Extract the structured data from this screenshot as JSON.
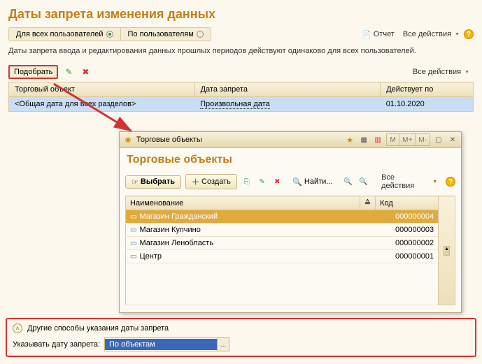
{
  "pageTitle": "Даты запрета изменения данных",
  "tabs": {
    "all": "Для всех пользователей",
    "byUsers": "По пользователям"
  },
  "topActions": {
    "report": "Отчет",
    "allActions": "Все действия"
  },
  "infoText": "Даты запрета ввода и редактирования данных прошлых периодов действуют одинаково для всех пользователей.",
  "mainToolbar": {
    "select": "Подобрать",
    "allActions": "Все действия"
  },
  "mainTable": {
    "columns": {
      "tradeObject": "Торговый объект",
      "banDate": "Дата запрета",
      "validUntil": "Действует по"
    },
    "rows": [
      {
        "tradeObject": "<Общая дата для всех разделов>",
        "banDate": "Произвольная дата",
        "validUntil": "01.10.2020"
      }
    ]
  },
  "dialog": {
    "titlebar": "Торговые объекты",
    "header": "Торговые объекты",
    "toolbar": {
      "choose": "Выбрать",
      "create": "Создать",
      "find": "Найти...",
      "allActions": "Все действия",
      "memory": {
        "m": "М",
        "mplus": "М+",
        "mminus": "М-"
      }
    },
    "columns": {
      "name": "Наименование",
      "code": "Код"
    },
    "rows": [
      {
        "name": "Магазин Гражданский",
        "code": "000000004"
      },
      {
        "name": "Магазин Купчино",
        "code": "000000003"
      },
      {
        "name": "Магазин Ленобласть",
        "code": "000000002"
      },
      {
        "name": "Центр",
        "code": "000000001"
      }
    ]
  },
  "bottom": {
    "heading": "Другие способы указания даты запрета",
    "label": "Указывать дату запрета:",
    "value": "По объектам"
  }
}
